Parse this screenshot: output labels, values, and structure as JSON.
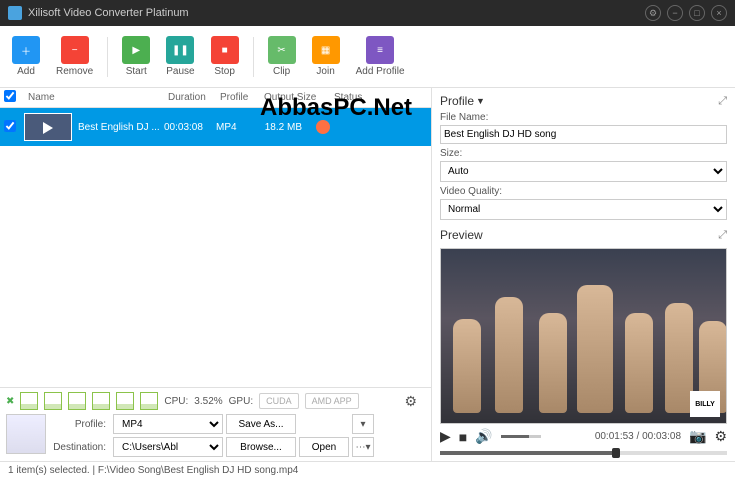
{
  "title": "Xilisoft Video Converter Platinum",
  "toolbar": {
    "add": "Add",
    "remove": "Remove",
    "start": "Start",
    "pause": "Pause",
    "stop": "Stop",
    "clip": "Clip",
    "join": "Join",
    "addprofile": "Add Profile"
  },
  "columns": {
    "name": "Name",
    "duration": "Duration",
    "profile": "Profile",
    "outputsize": "Output Size",
    "status": "Status"
  },
  "row": {
    "name": "Best English DJ ...",
    "duration": "00:03:08",
    "profile": "MP4",
    "size": "18.2 MB"
  },
  "cpu": {
    "label": "CPU:",
    "value": "3.52%",
    "gpulabel": "GPU:",
    "cuda": "CUDA",
    "amd": "AMD APP"
  },
  "dest": {
    "profilelabel": "Profile:",
    "profilevalue": "MP4",
    "saveas": "Save As...",
    "destlabel": "Destination:",
    "destvalue": "C:\\Users\\Abl",
    "browse": "Browse...",
    "open": "Open"
  },
  "status": "1 item(s) selected. | F:\\Video Song\\Best English DJ HD song.mp4",
  "profilepanel": {
    "head": "Profile",
    "filenamelabel": "File Name:",
    "filename": "Best English DJ HD song",
    "sizelabel": "Size:",
    "size": "Auto",
    "qualitylabel": "Video Quality:",
    "quality": "Normal"
  },
  "preview": {
    "head": "Preview",
    "time": "00:01:53 / 00:03:08"
  },
  "watermark": "AbbasPC.Net"
}
